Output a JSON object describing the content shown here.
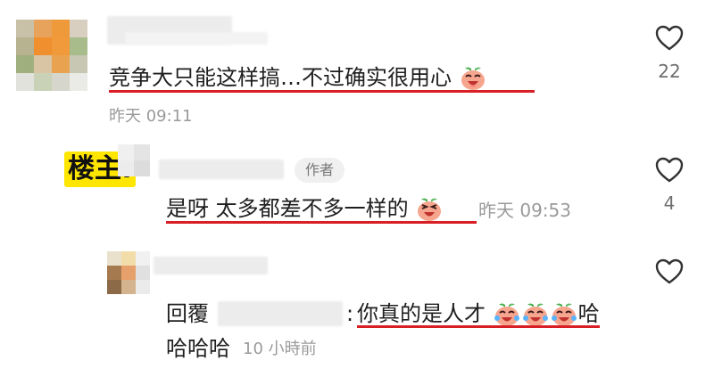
{
  "comments": [
    {
      "text": "竞争大只能这样搞…不过确实很用心",
      "timestamp": "昨天 09:11",
      "like_count": "22"
    },
    {
      "op_label": "楼主:",
      "author_badge": "作者",
      "text": "是呀 太多都差不多一样的",
      "timestamp": "昨天 09:53",
      "like_count": "4"
    },
    {
      "reply_prefix": "回覆",
      "reply_colon": ":",
      "text": "你真的是人才",
      "text_tail": "哈",
      "text_line2": "哈哈哈",
      "timestamp": "10 小時前"
    }
  ],
  "colors": {
    "underline": "#d81f26",
    "op_highlight": "#ffe600",
    "meta_text": "#9a9a9a"
  },
  "icons": [
    "heart-outline-icon",
    "laughing-peach-emoji",
    "crying-laughing-peach-emoji"
  ]
}
